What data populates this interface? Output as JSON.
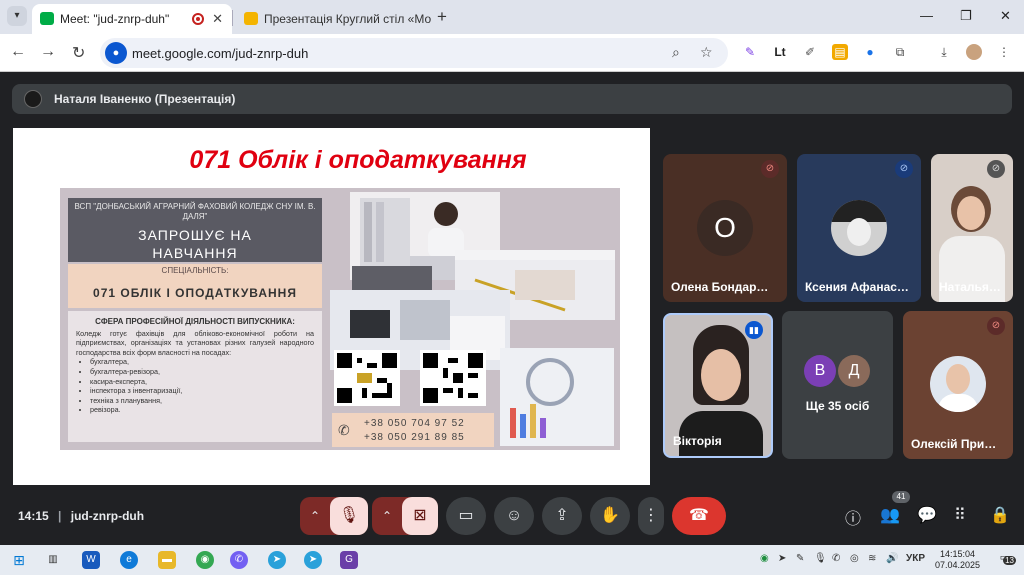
{
  "browser": {
    "tabs": [
      {
        "title": "Meet: \"jud-znrp-duh\"",
        "active": true
      },
      {
        "title": "Презентація Круглий стіл «Мо",
        "active": false
      }
    ],
    "url": "meet.google.com/jud-znrp-duh"
  },
  "meet": {
    "presenter_label": "Наталя Іваненко (Презентація)",
    "slide": {
      "title": "071 Облік і оподаткування",
      "poster": {
        "institution": "ВСП \"ДОНБАСЬКИЙ АГРАРНИЙ ФАХОВИЙ КОЛЕДЖ СНУ ІМ. В. ДАЛЯ\"",
        "invite_line1": "ЗАПРОШУЄ НА",
        "invite_line2": "НАВЧАННЯ",
        "specialty_label": "СПЕЦІАЛЬНІСТЬ:",
        "specialty": "071 ОБЛІК І ОПОДАТКУВАННЯ",
        "sphere_title": "СФЕРА ПРОФЕСІЙНОЇ ДІЯЛЬНОСТІ ВИПУСКНИКА:",
        "sphere_text": "Коледж готує фахівців для обліково-економічної роботи на підприємствах, організаціях та установах різних галузей народного господарства всіх форм власності на посадах:",
        "positions": [
          "бухгалтера,",
          "бухгалтера-ревізора,",
          "касира-експерта,",
          "інспектора з інвентаризації,",
          "техніка з планування,",
          "ревізора."
        ],
        "phone1": "+38 050 704 97 52",
        "phone2": "+38 050 291 89 85"
      }
    },
    "participants": [
      {
        "name": "Олена Бондар…",
        "initial": "О",
        "muted": true
      },
      {
        "name": "Ксения Афанас…",
        "muted": true
      },
      {
        "name": "Наталья…",
        "muted": true
      },
      {
        "name": "Вікторія",
        "speaking": true
      },
      {
        "name": "Олексій При…",
        "muted": true
      }
    ],
    "more": {
      "badges": [
        "В",
        "Д"
      ],
      "label": "Ще 35 осіб"
    },
    "time": "14:15",
    "meeting_code": "jud-znrp-duh",
    "people_count": "41"
  },
  "taskbar": {
    "language": "УКР",
    "time": "14:15:04",
    "date": "07.04.2025",
    "notifications": "13"
  },
  "colors": {
    "accent": "#0b57d0",
    "hangup": "#dc362e",
    "title_red": "#e00010"
  }
}
